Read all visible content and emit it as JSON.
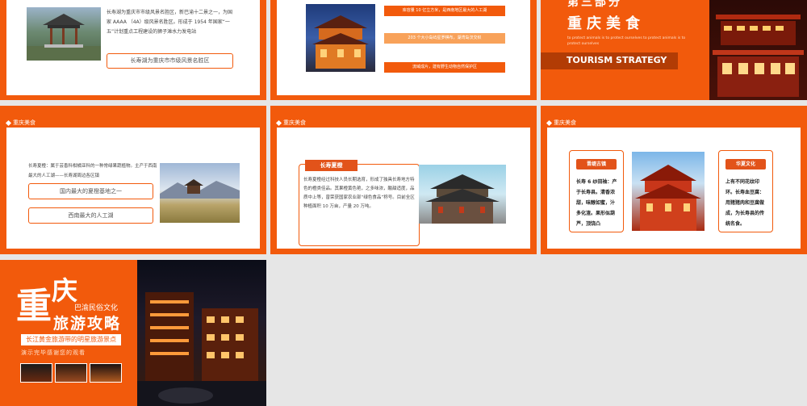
{
  "colors": {
    "accent": "#f25a0c",
    "dark_accent": "#e04e0b",
    "bg": "#e6e6e6"
  },
  "slide1": {
    "paragraph": "长寿湖为重庆市市级风景名胜区，新巴渝十二景之一，为国家 AAAA （4A）级风景名胜区。形成于 1954 年国家“一五”计划重点工程建设的狮子滩水力发电站",
    "box_label": "长寿湖为重庆市市级风景名胜区"
  },
  "slide2": {
    "bars": [
      "库容量 10 亿立方米，是西南地区最大的人工湖",
      "203 个大小岛屿星罗棋布，湖湾岛汊交织",
      "流域成片，建有野生动物自然保护区"
    ]
  },
  "slide3": {
    "part_label": "第三部分",
    "title": "重庆美食",
    "sub_en": "to protect animals is to protect ourselves to protect animals is to protect ourselves",
    "band": "TOURISM STRATEGY"
  },
  "slide4": {
    "tag": "重庆美食",
    "paragraph": "长寿夏橙：属于芸香科柑橘亚科的一种常绿果蔬植物。主产于西南最大的人工湖——长寿湖周边各区镇",
    "box1": "国内最大的夏橙基地之一",
    "box2": "西南最大的人工湖"
  },
  "slide5": {
    "tag": "重庆美食",
    "chip": "长寿夏橙",
    "paragraph": "长寿夏橙经过科技人员长期选育，形成了独具长寿地方特色的橙类佳品。其果橙黄色艳，之多味浓，酸甜适度，品质中上等，曾荣获国家农业部“绿色食品”称号。目前全区种植面积 10 万亩，产量 20 万吨。"
  },
  "slide6": {
    "tag": "重庆美食",
    "card1": {
      "chip": "晋缇古镇",
      "text": "长寿 6 纱田袖：产于长寿县。清香浓甜，味醇如蜜，汁多化渣。果形似葫芦，顶饶凸"
    },
    "card2": {
      "chip": "华夏文化",
      "text": "上有不同花纹印环。长寿血豆腐：用猪猪肉和豆腐做成，为长寿县的传统名食。"
    }
  },
  "slide7": {
    "big1": "重",
    "big2": "庆",
    "line_culture": "巴渝民俗文化",
    "title_rest": "旅游攻略",
    "banner": "长江黄金旅游带的明星旅游景点",
    "sub": "演示完毕感谢您的观看"
  }
}
